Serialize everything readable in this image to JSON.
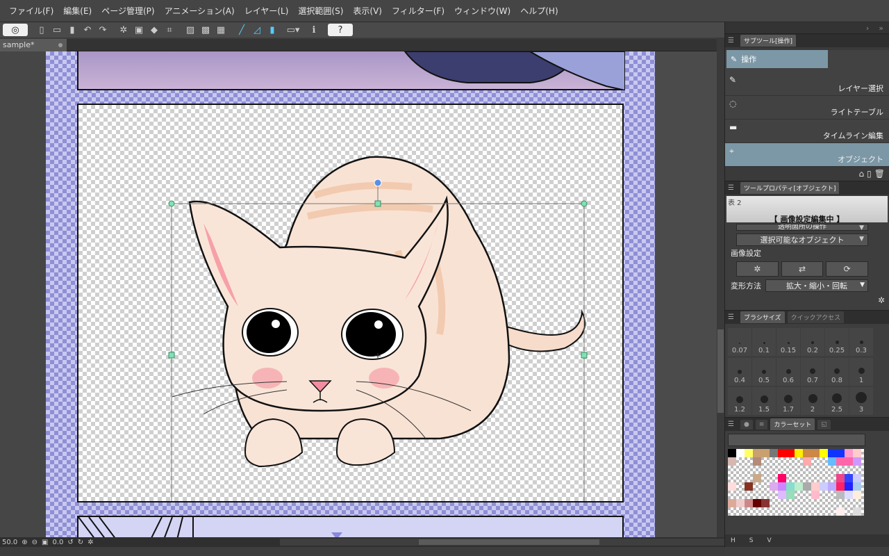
{
  "menu": [
    "ファイル(F)",
    "編集(E)",
    "ページ管理(P)",
    "アニメーション(A)",
    "レイヤー(L)",
    "選択範囲(S)",
    "表示(V)",
    "フィルター(F)",
    "ウィンドウ(W)",
    "ヘルプ(H)"
  ],
  "document_tab": "sample*",
  "status": {
    "zoom": "50.0",
    "angle": "0.0"
  },
  "subtool_panel": {
    "tab_label": "サブツール[操作]",
    "first_item": "操作",
    "items": [
      "レイヤー選択",
      "ライトテーブル",
      "タイムライン編集",
      "オブジェクト"
    ],
    "selected_index": 3
  },
  "tool_property": {
    "tab_label": "ツールプロパティ[オブジェクト]",
    "preview_number": "表 2",
    "editing_message": "【 画像設定編集中 】",
    "partial_dropdown": "透明箇所の操作",
    "selectable_dropdown": "選択可能なオブジェクト",
    "image_setting_label": "画像設定",
    "transform_label": "変形方法",
    "transform_value": "拡大・縮小・回転"
  },
  "brush_panel": {
    "tab_label": "ブラシサイズ",
    "tab2_label": "クイックアクセス",
    "sizes": [
      "0.07",
      "0.1",
      "0.15",
      "0.2",
      "0.25",
      "0.3",
      "0.4",
      "0.5",
      "0.6",
      "0.7",
      "0.8",
      "1",
      "1.2",
      "1.5",
      "1.7",
      "2",
      "2.5",
      "3"
    ]
  },
  "color_panel": {
    "tab_label": "カラーセット",
    "swatches": [
      "#000000",
      "#ffffff",
      "#ffff66",
      "#c9a070",
      "#c9a070",
      "#777777",
      "#ff0000",
      "#ff0000",
      "#ffee00",
      "#cc8844",
      "#cc8844",
      "#ffff00",
      "#1133ff",
      "#1133ff",
      "#ff99cc",
      "#ffcccc",
      "#d6b8b0",
      "",
      "",
      "#b48a7a",
      "",
      "",
      "",
      "",
      "",
      "#ffaaaa",
      "",
      "",
      "#66bbff",
      "#ff66aa",
      "#ff66aa",
      "#cc99ff",
      "",
      "",
      "",
      "",
      "",
      "",
      "",
      "",
      "",
      "",
      "",
      "",
      "",
      "",
      "",
      "",
      "",
      "",
      "",
      "#ccaa88",
      "",
      "",
      "#ff0066",
      "",
      "",
      "",
      "",
      "",
      "",
      "#ee4488",
      "#3344ff",
      "#ccccff",
      "#ffdddd",
      "",
      "#883322",
      "",
      "",
      "#ddaaee",
      "#cc88ff",
      "#88ddcc",
      "#bbeecc",
      "#aaaaaa",
      "#ffcccc",
      "#ccccff",
      "#bbaaff",
      "#ff2266",
      "#2222ff",
      "#aaccee",
      "",
      "",
      "",
      "",
      "",
      "",
      "#ddbbff",
      "#99ddbb",
      "",
      "",
      "#ffbbcc",
      "",
      "",
      "#bbbbbb",
      "#ddddff",
      "#ffeedd",
      "#ddaa99",
      "#eecccc",
      "#cc8888",
      "#660000",
      "#883333",
      "",
      "",
      "",
      "",
      "",
      "",
      "",
      "",
      "",
      "",
      "",
      "",
      "",
      "",
      "",
      "",
      "",
      "",
      "",
      "",
      "",
      "",
      "",
      "",
      "#ffeeee",
      "",
      "#dddddd"
    ],
    "bottom": [
      "H",
      "S",
      "V"
    ]
  }
}
